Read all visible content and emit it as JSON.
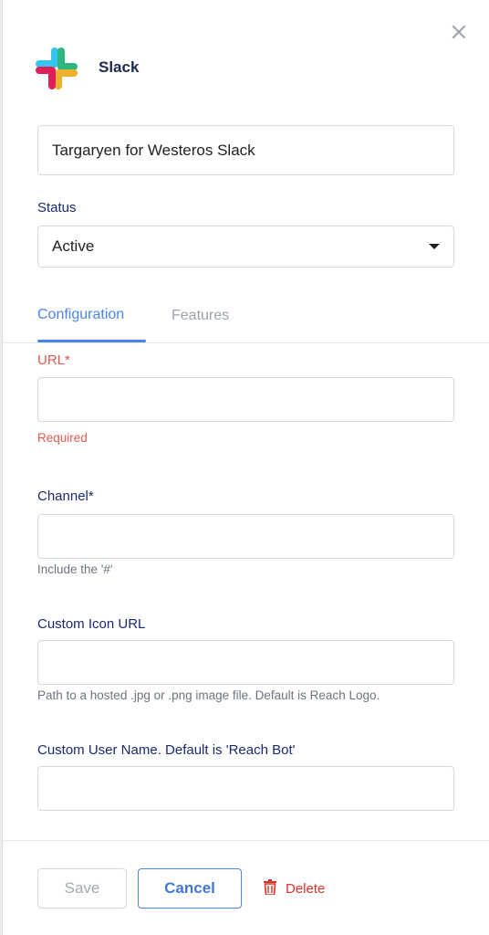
{
  "header": {
    "app_name": "Slack",
    "close_icon": "close-icon",
    "logo_icon": "slack-logo"
  },
  "integration_name": {
    "value": "Targaryen for Westeros Slack"
  },
  "status": {
    "label": "Status",
    "value": "Active"
  },
  "tabs": [
    {
      "label": "Configuration",
      "active": true
    },
    {
      "label": "Features",
      "active": false
    }
  ],
  "fields": {
    "url": {
      "label": "URL*",
      "value": "",
      "error": "Required"
    },
    "channel": {
      "label": "Channel*",
      "value": "",
      "help": "Include the '#'"
    },
    "custom_icon_url": {
      "label": "Custom Icon URL",
      "value": "",
      "help": "Path to a hosted .jpg or .png image file. Default is Reach Logo."
    },
    "custom_user_name": {
      "label": "Custom User Name. Default is 'Reach Bot'",
      "value": ""
    }
  },
  "footer": {
    "save_label": "Save",
    "cancel_label": "Cancel",
    "delete_label": "Delete",
    "delete_icon": "trash-icon"
  },
  "colors": {
    "accent": "#4a86e8",
    "error": "#e05a4f",
    "label": "#1b2a6e",
    "delete": "#d9342b"
  }
}
